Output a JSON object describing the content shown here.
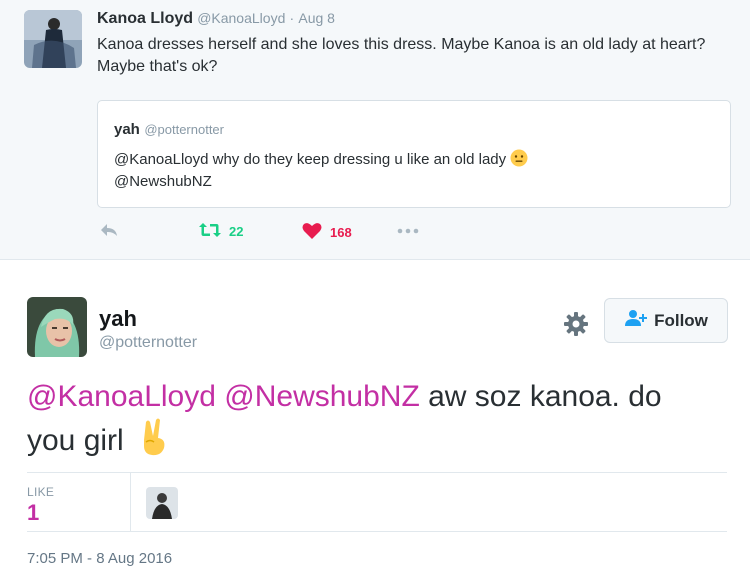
{
  "parent_tweet": {
    "author_name": "Kanoa Lloyd",
    "author_handle": "@KanoaLloyd",
    "separator": "·",
    "date": "Aug 8",
    "text": "Kanoa dresses herself and she loves this dress. Maybe Kanoa is an old lady at heart? Maybe that's ok?",
    "quoted": {
      "author_name": "yah",
      "author_handle": "@potternotter",
      "text": "@KanoaLloyd why do they keep dressing u like an old lady",
      "text_line2": "@NewshubNZ",
      "emoji": "neutral-face-icon"
    },
    "actions": {
      "reply_icon": "reply-icon",
      "retweet_icon": "retweet-icon",
      "retweet_count": "22",
      "like_icon": "heart-icon",
      "like_count": "168",
      "more_icon": "more-dots-icon"
    }
  },
  "tweet": {
    "author_name": "yah",
    "author_handle": "@potternotter",
    "follow_label": "Follow",
    "mention_1": "@KanoaLloyd",
    "mention_2": "@NewshubNZ",
    "text_rest": " aw soz kanoa. do",
    "text_line2": "you girl",
    "emoji": "victory-hand-icon",
    "likes_label": "LIKE",
    "likes_count": "1",
    "timestamp": "7:05 PM - 8 Aug 2016"
  },
  "colors": {
    "mention": "#c32fa4",
    "retweet": "#19cf86",
    "like": "#e81c4f",
    "muted": "#8899a6",
    "background_parent": "#f5f8fa"
  }
}
